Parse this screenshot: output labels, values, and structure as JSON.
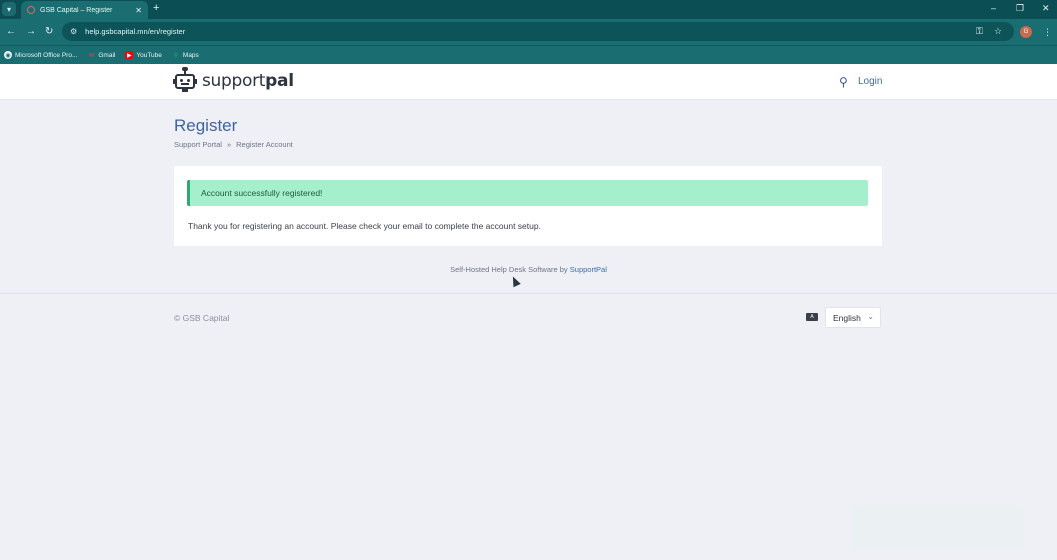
{
  "browser": {
    "tab_title": "GSB Capital – Register",
    "url": "help.gsbcapital.mn/en/register",
    "bookmarks": [
      {
        "label": "Microsoft Office Pro...",
        "icon": "office-icon"
      },
      {
        "label": "Gmail",
        "icon": "gmail-icon"
      },
      {
        "label": "YouTube",
        "icon": "youtube-icon"
      },
      {
        "label": "Maps",
        "icon": "maps-icon"
      }
    ],
    "avatar_letter": "G"
  },
  "header": {
    "logo_text_light": "support",
    "logo_text_bold": "pal",
    "login_label": "Login"
  },
  "page": {
    "title": "Register",
    "breadcrumb": [
      "Support Portal",
      "Register Account"
    ],
    "breadcrumb_separator": "»",
    "alert": "Account successfully registered!",
    "message": "Thank you for registering an account. Please check your email to complete the account setup."
  },
  "footer": {
    "powered_prefix": "Self-Hosted Help Desk Software by ",
    "powered_link": "SupportPal",
    "copyright": "© GSB Capital",
    "language": "English"
  },
  "colors": {
    "chrome": "#1a6e72",
    "accent": "#3f64a0",
    "alert_bg": "#a6efcc",
    "alert_border": "#2fa871"
  }
}
